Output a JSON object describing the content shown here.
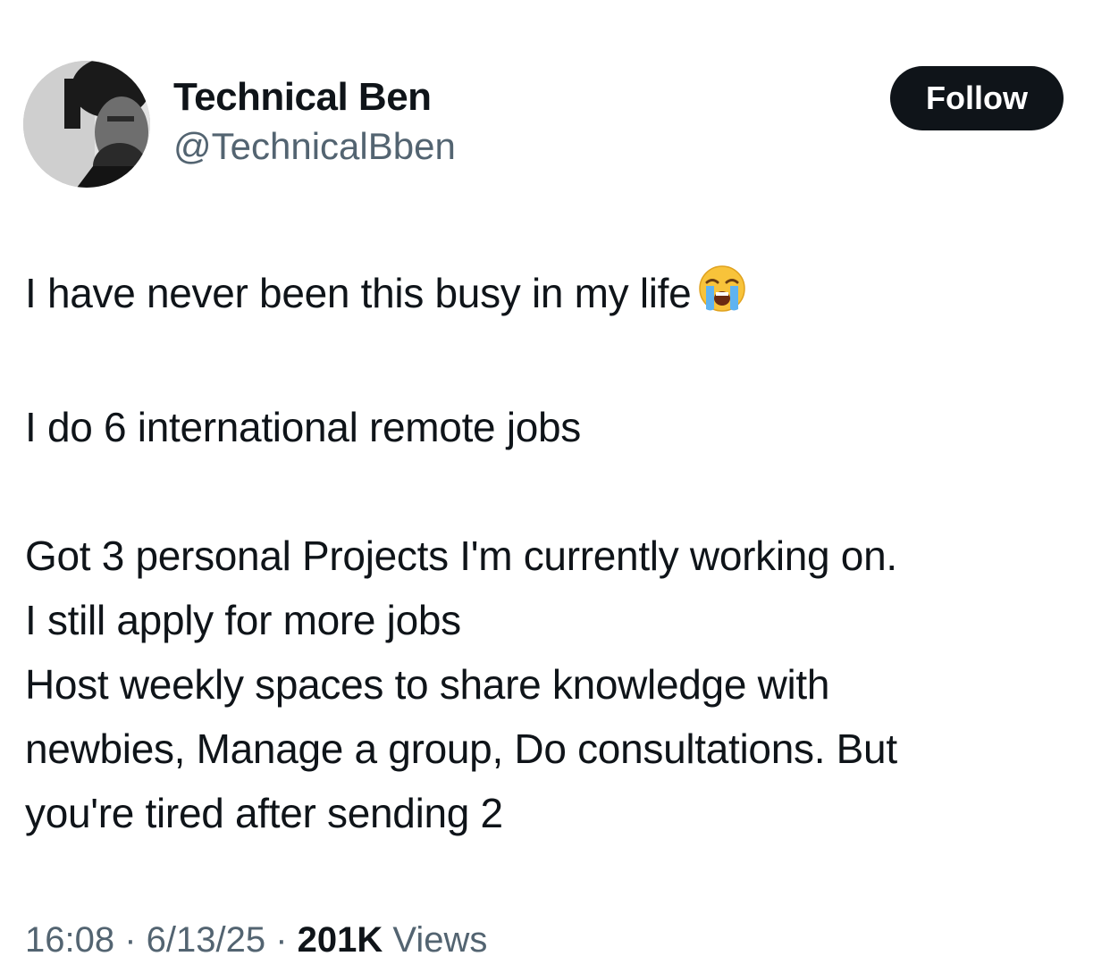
{
  "author": {
    "display_name": "Technical Ben",
    "handle": "@TechnicalBben"
  },
  "follow_label": "Follow",
  "tweet": {
    "line1": "I have never been this busy in my life",
    "emoji_icon": "loudly-crying-face-icon",
    "line2": "I do 6 international remote jobs",
    "line3": "Got 3 personal Projects I'm currently working on.",
    "line4": "I still apply for more jobs",
    "line5": "Host weekly spaces to share knowledge with",
    "line6": "newbies, Manage a group, Do consultations.  But",
    "line7": "you're tired after sending 2"
  },
  "meta": {
    "time": "16:08",
    "sep1": " · ",
    "date": "6/13/25",
    "sep2": " · ",
    "views_count": "201K",
    "views_label": " Views"
  }
}
